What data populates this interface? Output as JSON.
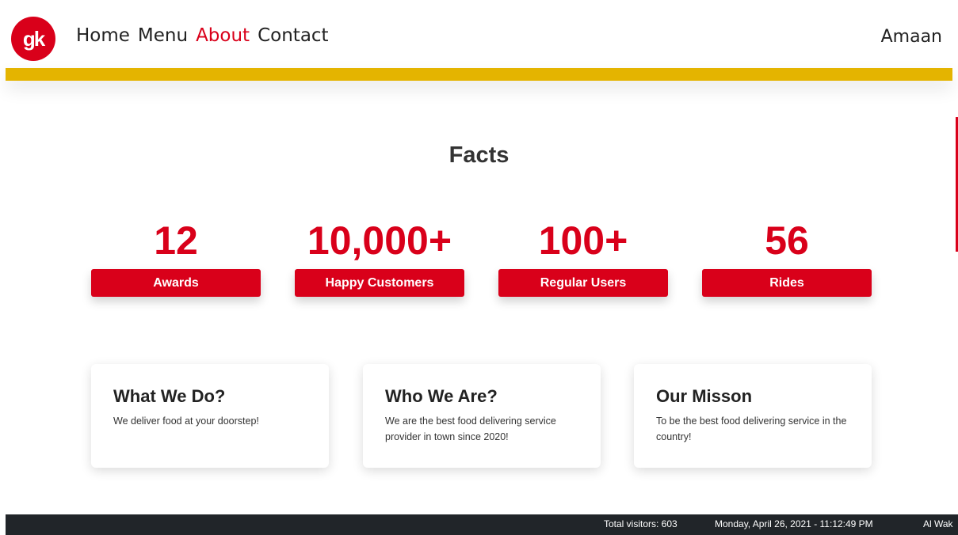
{
  "header": {
    "logo_text": "gk",
    "nav": [
      "Home",
      "Menu",
      "About",
      "Contact"
    ],
    "active_nav": "About",
    "user": "Amaan"
  },
  "facts": {
    "title": "Facts",
    "items": [
      {
        "value": "12",
        "label": "Awards"
      },
      {
        "value": "10,000+",
        "label": "Happy Customers"
      },
      {
        "value": "100+",
        "label": "Regular Users"
      },
      {
        "value": "56",
        "label": "Rides"
      }
    ]
  },
  "cards": [
    {
      "title": "What We Do?",
      "text": "We deliver food at your doorstep!"
    },
    {
      "title": "Who We Are?",
      "text": "We are the best food delivering service provider in town since 2020!"
    },
    {
      "title": "Our Misson",
      "text": "To be the best food delivering service in the country!"
    }
  ],
  "footer": {
    "visitors": "Total visitors: 603",
    "datetime": "Monday, April 26, 2021 - 11:12:49 PM",
    "location": "Al Wak"
  },
  "colors": {
    "accent": "#d9001a",
    "band": "#e4b400",
    "footer_bg": "#212529"
  }
}
